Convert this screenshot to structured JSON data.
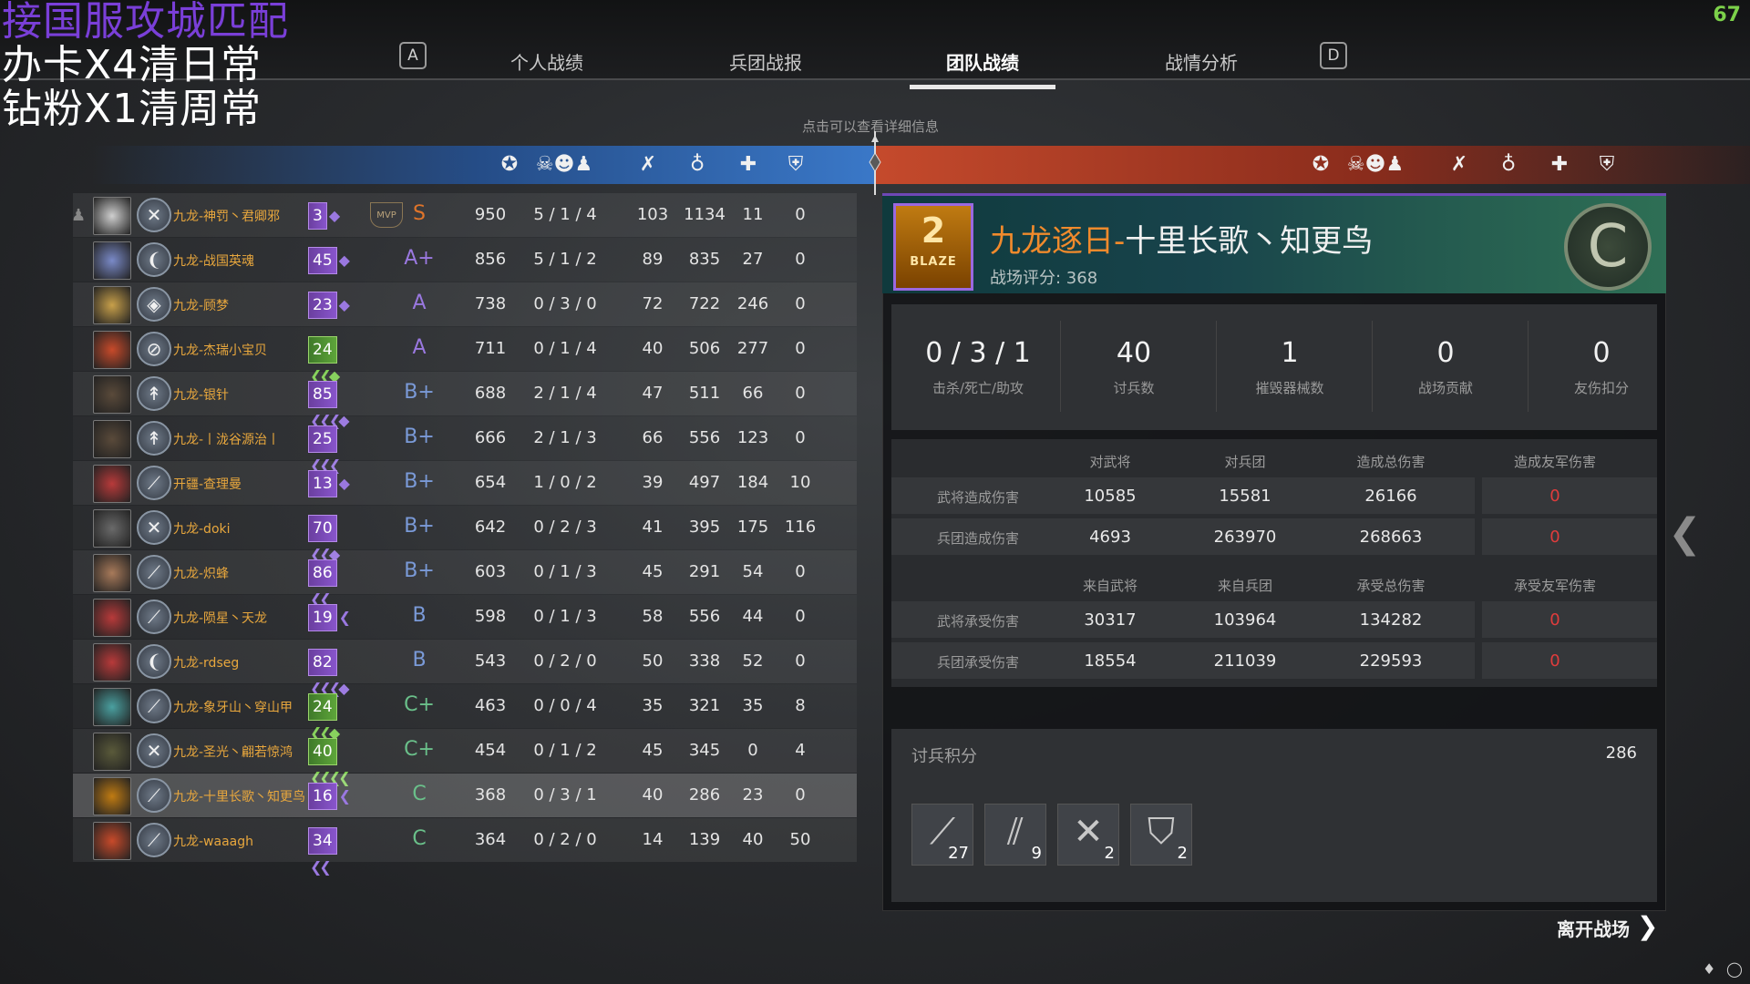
{
  "overlay": {
    "line1": "接国服攻城匹配",
    "line2": "办卡X4清日常",
    "line3": "钻粉X1清周常",
    "colors": [
      "#7a3fd8",
      "#ffffff",
      "#ffffff"
    ]
  },
  "fps": "67",
  "nav": {
    "key_left": "A",
    "key_right": "D",
    "tabs": [
      {
        "label": "个人战绩",
        "active": false
      },
      {
        "label": "兵团战报",
        "active": false
      },
      {
        "label": "团队战绩",
        "active": true
      },
      {
        "label": "战情分析",
        "active": false
      }
    ]
  },
  "hint": "点击可以查看详细信息",
  "header_icons": [
    "score-icon",
    "kills-deaths-assists-icon",
    "soldier-kills-icon",
    "hero-damage-icon",
    "healing-icon",
    "siege-icon"
  ],
  "players": [
    {
      "name": "九龙-神罚丶君卿邪",
      "level": "3",
      "chev": "◆",
      "mvp": true,
      "grade": "S",
      "score": "950",
      "kda": "5 / 1 / 4",
      "kills": "103",
      "dmg": "1134",
      "heal": "11",
      "siege": "0",
      "lvcolor": "purple",
      "gcolor": "#e0742a",
      "weapon": "✕",
      "avatar": "#cfcfcf"
    },
    {
      "name": "九龙-战国英魂",
      "level": "45",
      "chev": "◆",
      "mvp": false,
      "grade": "A+",
      "score": "856",
      "kda": "5 / 1 / 2",
      "kills": "89",
      "dmg": "835",
      "heal": "27",
      "siege": "0",
      "lvcolor": "purple",
      "gcolor": "#9a78e0",
      "weapon": "❨",
      "avatar": "#7a8ac8"
    },
    {
      "name": "九龙-顾梦",
      "level": "23",
      "chev": "◆",
      "mvp": false,
      "grade": "A",
      "score": "738",
      "kda": "0 / 3 / 0",
      "kills": "72",
      "dmg": "722",
      "heal": "246",
      "siege": "0",
      "lvcolor": "purple",
      "gcolor": "#9a78e0",
      "weapon": "◈",
      "avatar": "#c8a04a"
    },
    {
      "name": "九龙-杰瑞小宝贝",
      "level": "24",
      "chev": "❮❮◆",
      "mvp": false,
      "grade": "A",
      "score": "711",
      "kda": "0 / 1 / 4",
      "kills": "40",
      "dmg": "506",
      "heal": "277",
      "siege": "0",
      "lvcolor": "green",
      "gcolor": "#9a78e0",
      "weapon": "⊘",
      "avatar": "#c84a2a"
    },
    {
      "name": "九龙-银针",
      "level": "85",
      "chev": "❮❮❮◆",
      "mvp": false,
      "grade": "B+",
      "score": "688",
      "kda": "2 / 1 / 4",
      "kills": "47",
      "dmg": "511",
      "heal": "66",
      "siege": "0",
      "lvcolor": "purple",
      "gcolor": "#7a9ad8",
      "weapon": "↟",
      "avatar": "#5a4a3a"
    },
    {
      "name": "九龙-丨泷谷源治丨",
      "level": "25",
      "chev": "❮❮❮",
      "mvp": false,
      "grade": "B+",
      "score": "666",
      "kda": "2 / 1 / 3",
      "kills": "66",
      "dmg": "556",
      "heal": "123",
      "siege": "0",
      "lvcolor": "purple",
      "gcolor": "#7a9ad8",
      "weapon": "↟",
      "avatar": "#5a4a3a"
    },
    {
      "name": "开疆-查理曼",
      "level": "13",
      "chev": "◆",
      "mvp": false,
      "grade": "B+",
      "score": "654",
      "kda": "1 / 0 / 2",
      "kills": "39",
      "dmg": "497",
      "heal": "184",
      "siege": "10",
      "lvcolor": "purple",
      "gcolor": "#7a9ad8",
      "weapon": "⟋",
      "avatar": "#b83a3a"
    },
    {
      "name": "九龙-doki",
      "level": "70",
      "chev": "❮❮◆",
      "mvp": false,
      "grade": "B+",
      "score": "642",
      "kda": "0 / 2 / 3",
      "kills": "41",
      "dmg": "395",
      "heal": "175",
      "siege": "116",
      "lvcolor": "purple",
      "gcolor": "#7a9ad8",
      "weapon": "✕",
      "avatar": "#6a6a6a"
    },
    {
      "name": "九龙-炽蜂",
      "level": "86",
      "chev": "❮❮",
      "mvp": false,
      "grade": "B+",
      "score": "603",
      "kda": "0 / 1 / 3",
      "kills": "45",
      "dmg": "291",
      "heal": "54",
      "siege": "0",
      "lvcolor": "purple",
      "gcolor": "#7a9ad8",
      "weapon": "⟋",
      "avatar": "#a87a5a"
    },
    {
      "name": "九龙-陨星丶天龙",
      "level": "19",
      "chev": "❮",
      "mvp": false,
      "grade": "B",
      "score": "598",
      "kda": "0 / 1 / 3",
      "kills": "58",
      "dmg": "556",
      "heal": "44",
      "siege": "0",
      "lvcolor": "purple",
      "gcolor": "#7a9ad8",
      "weapon": "⟋",
      "avatar": "#b83a3a"
    },
    {
      "name": "九龙-rdseg",
      "level": "82",
      "chev": "❮❮❮◆",
      "mvp": false,
      "grade": "B",
      "score": "543",
      "kda": "0 / 2 / 0",
      "kills": "50",
      "dmg": "338",
      "heal": "52",
      "siege": "0",
      "lvcolor": "purple",
      "gcolor": "#7a9ad8",
      "weapon": "❨",
      "avatar": "#b83a3a"
    },
    {
      "name": "九龙-象牙山丶穿山甲",
      "level": "24",
      "chev": "❮❮◆",
      "mvp": false,
      "grade": "C+",
      "score": "463",
      "kda": "0 / 0 / 4",
      "kills": "35",
      "dmg": "321",
      "heal": "35",
      "siege": "8",
      "lvcolor": "green",
      "gcolor": "#6ac08a",
      "weapon": "⟋",
      "avatar": "#4aa0a0"
    },
    {
      "name": "九龙-圣光丶翩若惊鸿",
      "level": "40",
      "chev": "❮❮❮❮",
      "mvp": false,
      "grade": "C+",
      "score": "454",
      "kda": "0 / 1 / 2",
      "kills": "45",
      "dmg": "345",
      "heal": "0",
      "siege": "4",
      "lvcolor": "green",
      "gcolor": "#6ac08a",
      "weapon": "✕",
      "avatar": "#5a5a3a"
    },
    {
      "name": "九龙-十里长歌丶知更鸟",
      "level": "16",
      "chev": "❮",
      "mvp": false,
      "grade": "C",
      "score": "368",
      "kda": "0 / 3 / 1",
      "kills": "40",
      "dmg": "286",
      "heal": "23",
      "siege": "0",
      "lvcolor": "purple",
      "gcolor": "#6ac08a",
      "weapon": "⟋",
      "avatar": "#c07b12",
      "me": true
    },
    {
      "name": "九龙-waaagh",
      "level": "34",
      "chev": "❮❮",
      "mvp": false,
      "grade": "C",
      "score": "364",
      "kda": "0 / 2 / 0",
      "kills": "14",
      "dmg": "139",
      "heal": "40",
      "siege": "50",
      "lvcolor": "purple",
      "gcolor": "#6ac08a",
      "weapon": "⟋",
      "avatar": "#c84a2a"
    }
  ],
  "detail": {
    "emblem_num": "2",
    "emblem_text": "BLAZE",
    "name_prefix": "九龙逐日-",
    "name_main": "十里长歌丶知更鸟",
    "score_label": "战场评分: 368",
    "grade": "C",
    "stats": [
      {
        "value": "0 / 3 / 1",
        "label": "击杀/死亡/助攻"
      },
      {
        "value": "40",
        "label": "讨兵数"
      },
      {
        "value": "1",
        "label": "摧毁器械数"
      },
      {
        "value": "0",
        "label": "战场贡献"
      },
      {
        "value": "0",
        "label": "友伤扣分"
      }
    ],
    "dealt_headers": [
      "对武将",
      "对兵团",
      "造成总伤害",
      "造成友军伤害"
    ],
    "dealt_rows": [
      {
        "label": "武将造成伤害",
        "values": [
          "10585",
          "15581",
          "26166",
          "0"
        ]
      },
      {
        "label": "兵团造成伤害",
        "values": [
          "4693",
          "263970",
          "268663",
          "0"
        ]
      }
    ],
    "taken_headers": [
      "来自武将",
      "来自兵团",
      "承受总伤害",
      "承受友军伤害"
    ],
    "taken_rows": [
      {
        "label": "武将承受伤害",
        "values": [
          "30317",
          "103964",
          "134282",
          "0"
        ]
      },
      {
        "label": "兵团承受伤害",
        "values": [
          "18554",
          "211039",
          "229593",
          "0"
        ]
      }
    ],
    "kill_label": "讨兵积分",
    "kill_total": "286",
    "units": [
      {
        "icon": "spear-unit-icon",
        "glyph": "⟋",
        "count": "27"
      },
      {
        "icon": "pike-unit-icon",
        "glyph": "⫽",
        "count": "9"
      },
      {
        "icon": "bow-unit-icon",
        "glyph": "✕",
        "count": "2"
      },
      {
        "icon": "shield-unit-icon",
        "glyph": "⛉",
        "count": "2"
      }
    ]
  },
  "leave_label": "离开战场"
}
